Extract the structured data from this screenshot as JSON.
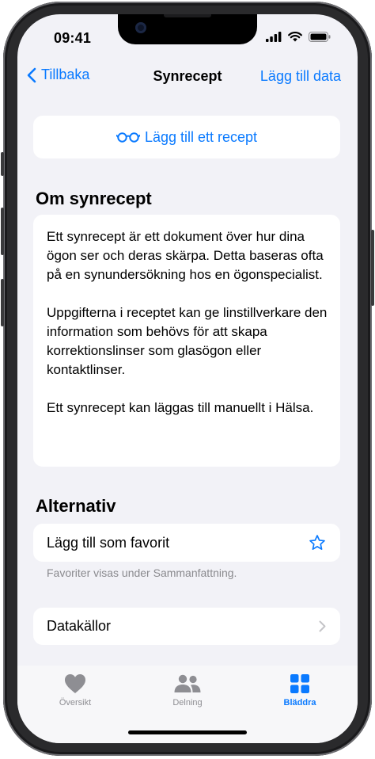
{
  "status_bar": {
    "time": "09:41"
  },
  "nav": {
    "back_label": "Tillbaka",
    "title": "Synrecept",
    "action_label": "Lägg till data"
  },
  "add_recipe": {
    "label": "Lägg till ett recept",
    "icon": "glasses-icon"
  },
  "about": {
    "heading": "Om synrecept",
    "paragraphs": [
      "Ett synrecept är ett dokument över hur dina ögon ser och deras skärpa. Detta baseras ofta på en synundersökning hos en ögonspecialist.",
      "Uppgifterna i receptet kan ge linstillverkare den information som behövs för att skapa korrektionslinser som glasögon eller kontaktlinser.",
      "Ett synrecept kan läggas till manuellt i Hälsa."
    ]
  },
  "options": {
    "heading": "Alternativ",
    "favorite_label": "Lägg till som favorit",
    "favorite_footnote": "Favoriter visas under Sammanfattning.",
    "sources_label": "Datakällor"
  },
  "tabs": [
    {
      "label": "Översikt",
      "icon": "heart-icon",
      "active": false
    },
    {
      "label": "Delning",
      "icon": "people-icon",
      "active": false
    },
    {
      "label": "Bläddra",
      "icon": "grid-icon",
      "active": true
    }
  ],
  "colors": {
    "accent": "#0a7aff",
    "background": "#f2f2f7",
    "inactive": "#8e8e93"
  }
}
